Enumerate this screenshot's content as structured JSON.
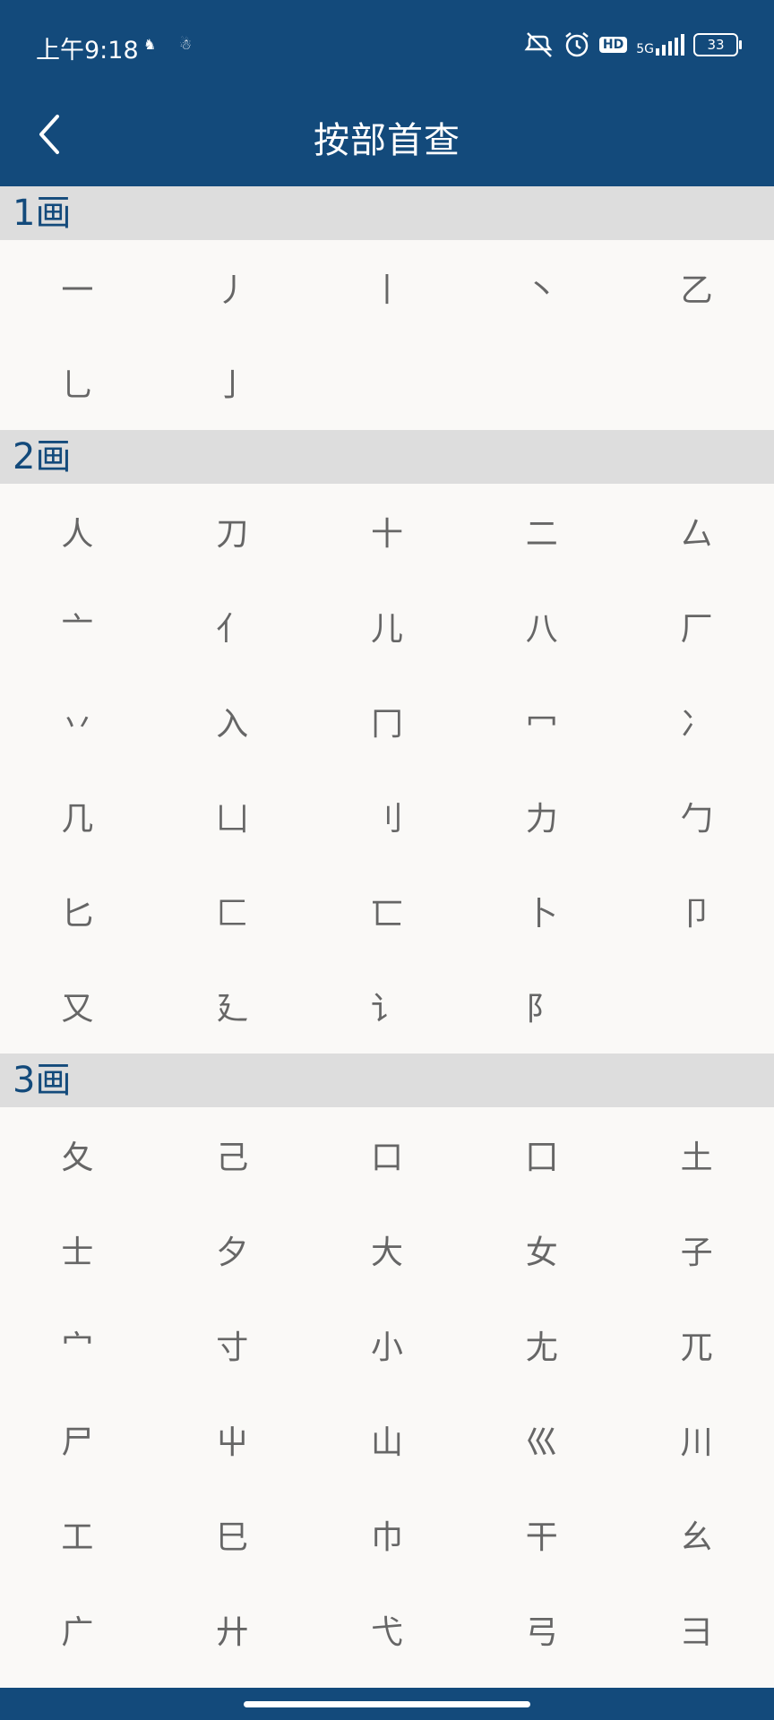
{
  "status_bar": {
    "time": "上午9:18",
    "network_label": "5G",
    "battery_level": "33",
    "icons": [
      "notification-icon",
      "notification-icon-2",
      "mute-vibrate-icon",
      "alarm-icon",
      "hd-icon",
      "signal-icon",
      "battery-icon"
    ]
  },
  "header": {
    "title": "按部首查",
    "back_icon": "chevron-left-icon"
  },
  "colors": {
    "primary": "#134a7b",
    "section_bg": "#dddddd",
    "radical_text": "#666666",
    "page_bg": "#faf9f7"
  },
  "sections": [
    {
      "label": "1画",
      "radicals": [
        "一",
        "丿",
        "丨",
        "丶",
        "乙",
        "乚",
        "亅"
      ]
    },
    {
      "label": "2画",
      "radicals": [
        "人",
        "刀",
        "十",
        "二",
        "厶",
        "亠",
        "亻",
        "儿",
        "八",
        "厂",
        "丷",
        "入",
        "冂",
        "冖",
        "冫",
        "几",
        "凵",
        "刂",
        "力",
        "勹",
        "匕",
        "匚",
        "匸",
        "卜",
        "卩",
        "又",
        "廴",
        "讠",
        "阝"
      ]
    },
    {
      "label": "3画",
      "radicals": [
        "夂",
        "己",
        "口",
        "囗",
        "土",
        "士",
        "夕",
        "大",
        "女",
        "子",
        "宀",
        "寸",
        "小",
        "尢",
        "兀",
        "尸",
        "屮",
        "山",
        "巛",
        "川",
        "工",
        "巳",
        "巾",
        "干",
        "幺",
        "广",
        "廾",
        "弋",
        "弓",
        "彐"
      ]
    }
  ]
}
